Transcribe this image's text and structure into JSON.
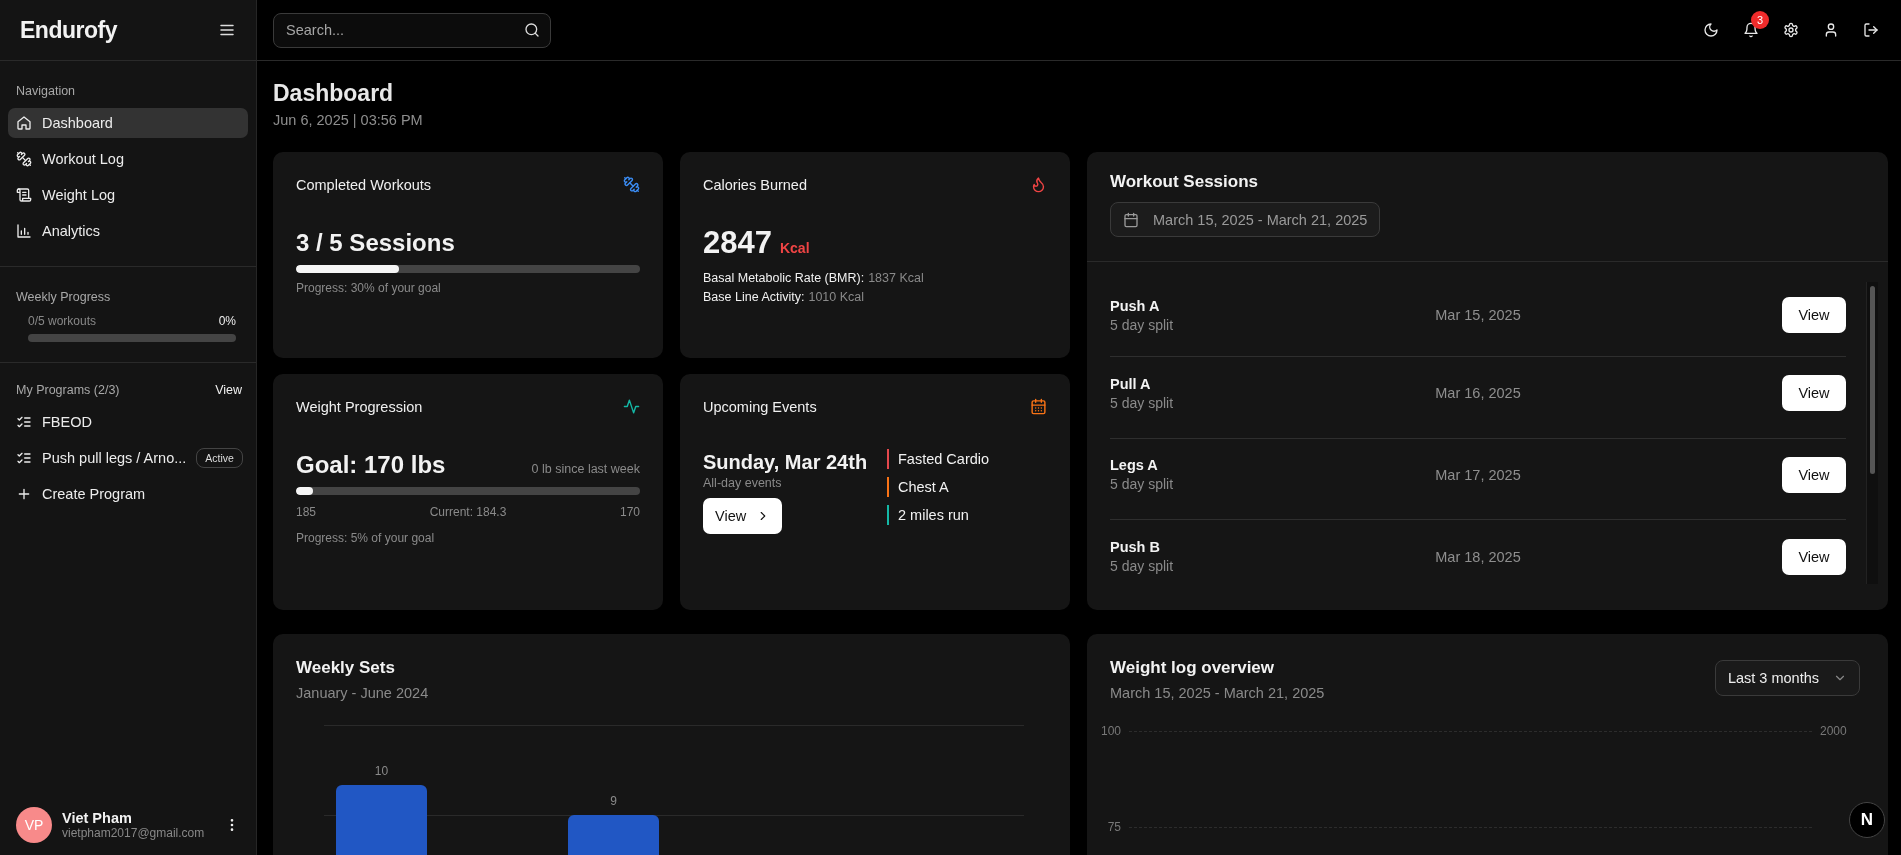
{
  "sidebar": {
    "logo": "Endurofy",
    "nav_heading": "Navigation",
    "nav_items": [
      {
        "label": "Dashboard",
        "selected": true
      },
      {
        "label": "Workout Log",
        "selected": false
      },
      {
        "label": "Weight Log",
        "selected": false
      },
      {
        "label": "Analytics",
        "selected": false
      }
    ],
    "weekly_progress": {
      "heading": "Weekly Progress",
      "label": "0/5 workouts",
      "percent": "0%",
      "level": 0
    },
    "programs": {
      "heading": "My Programs (2/3)",
      "view_link": "View",
      "items": [
        {
          "label": "FBEOD"
        },
        {
          "label": "Push pull legs / Arno...",
          "badge": "Active"
        }
      ],
      "create_label": "Create Program"
    },
    "user": {
      "initials": "VP",
      "name": "Viet Pham",
      "email": "vietpham2017@gmail.com"
    }
  },
  "topbar": {
    "search_placeholder": "Search...",
    "notification_count": "3"
  },
  "page": {
    "title": "Dashboard",
    "date": "Jun 6, 2025 | 03:56 PM"
  },
  "completed_workouts": {
    "title": "Completed Workouts",
    "value": "3 / 5 Sessions",
    "level": 0.3,
    "caption": "Progress: 30% of your goal"
  },
  "calories": {
    "title": "Calories Burned",
    "value": "2847",
    "unit": "Kcal",
    "details": [
      {
        "label": "Basal Metabolic Rate (BMR):",
        "value": "1837 Kcal"
      },
      {
        "label": "Base Line Activity:",
        "value": "1010 Kcal"
      }
    ]
  },
  "weight_progression": {
    "title": "Weight Progression",
    "goal": "Goal: 170 lbs",
    "change": "0 lb since last week",
    "level": 0.05,
    "start": "185",
    "current": "Current: 184.3",
    "target": "170",
    "caption": "Progress: 5% of your goal"
  },
  "upcoming_events": {
    "title": "Upcoming Events",
    "date": "Sunday, Mar 24th",
    "subtitle": "All-day events",
    "button": "View",
    "events": [
      {
        "label": "Fasted Cardio",
        "color": "#e5484d"
      },
      {
        "label": "Chest A",
        "color": "#f97316"
      },
      {
        "label": "2 miles run",
        "color": "#14b8a6"
      }
    ]
  },
  "workout_sessions": {
    "title": "Workout Sessions",
    "date_range": "March 15, 2025 - March 21, 2025",
    "rows": [
      {
        "name": "Push A",
        "program": "5 day split",
        "date": "Mar 15, 2025",
        "button": "View"
      },
      {
        "name": "Pull A",
        "program": "5 day split",
        "date": "Mar 16, 2025",
        "button": "View"
      },
      {
        "name": "Legs A",
        "program": "5 day split",
        "date": "Mar 17, 2025",
        "button": "View"
      },
      {
        "name": "Push B",
        "program": "5 day split",
        "date": "Mar 18, 2025",
        "button": "View"
      }
    ]
  },
  "weekly_sets": {
    "title": "Weekly Sets",
    "subtitle": "January - June 2024",
    "bar_labels": [
      "10",
      "9"
    ]
  },
  "weight_log": {
    "title": "Weight log overview",
    "subtitle": "March 15, 2025 - March 21, 2025",
    "range_select": "Last 3 months",
    "left_axis": [
      "100",
      "75"
    ],
    "right_axis": [
      "2000"
    ]
  },
  "dev_badge": "N"
}
